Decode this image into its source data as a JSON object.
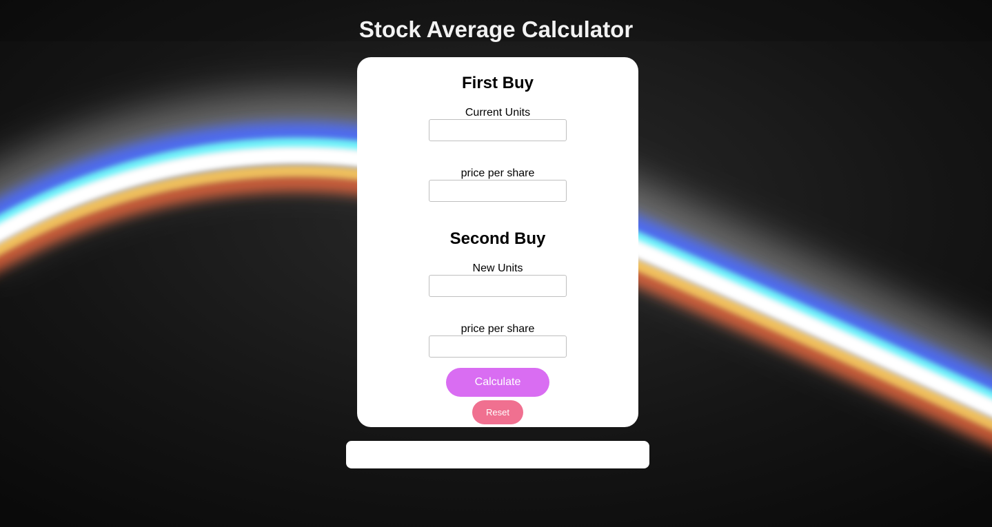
{
  "page": {
    "title": "Stock Average Calculator",
    "background_color": "#101010"
  },
  "first_buy": {
    "heading": "First Buy",
    "units_label": "Current Units",
    "units_value": "",
    "price_label": "price per share",
    "price_value": ""
  },
  "second_buy": {
    "heading": "Second Buy",
    "units_label": "New Units",
    "units_value": "",
    "price_label": "price per share",
    "price_value": ""
  },
  "actions": {
    "calculate_label": "Calculate",
    "calculate_color": "#d96df2",
    "reset_label": "Reset",
    "reset_color": "#f07090"
  },
  "result": {
    "text": ""
  }
}
